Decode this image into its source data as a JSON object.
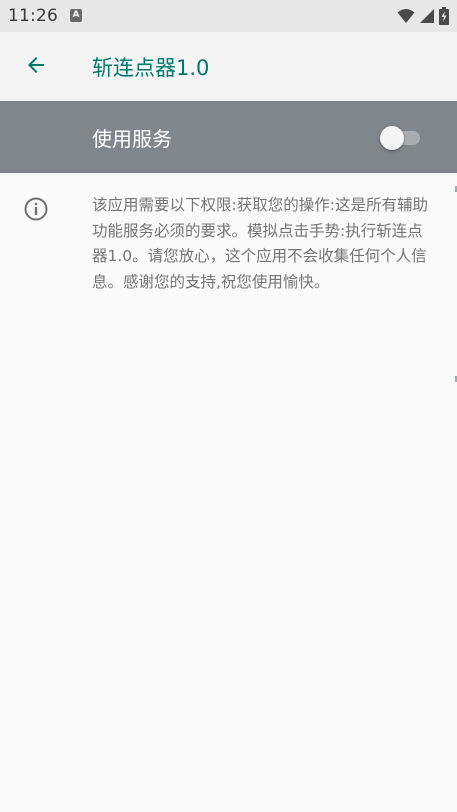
{
  "status_bar": {
    "time": "11:26",
    "notification_icon": "accessibility-a-icon",
    "notification_letter": "A",
    "icons": [
      "wifi-icon",
      "signal-icon",
      "battery-charging-icon"
    ]
  },
  "app_bar": {
    "back_icon": "arrow-back-icon",
    "title": "斩连点器1.0",
    "title_color": "#00796b"
  },
  "service": {
    "label": "使用服务",
    "toggle_state": "off",
    "row_color": "#81868c"
  },
  "info": {
    "icon": "info-icon",
    "text": "该应用需要以下权限:获取您的操作:这是所有辅助功能服务必须的要求。模拟点击手势:执行斩连点器1.0。请您放心，这个应用不会收集任何个人信息。感谢您的支持,祝您使用愉快。"
  }
}
